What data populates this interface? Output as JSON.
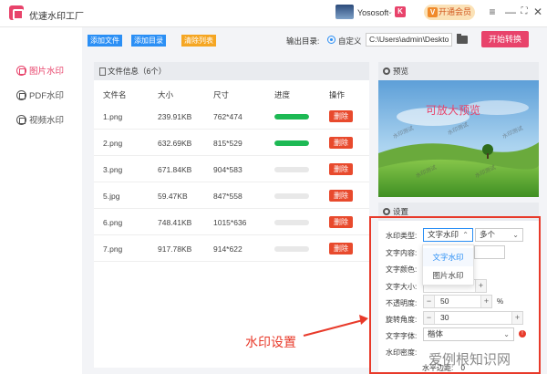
{
  "app": {
    "title": "优速水印工厂"
  },
  "user": {
    "name": "Yososoft",
    "caret": "⌄",
    "flag": "K",
    "vip_label": "开通会员",
    "vip_icon": "V"
  },
  "window": {
    "menu": "≡",
    "minimize": "—",
    "maximize": "⛶",
    "close": "✕"
  },
  "sidebar": {
    "items": [
      {
        "label": "图片水印",
        "active": true
      },
      {
        "label": "PDF水印",
        "active": false
      },
      {
        "label": "视频水印",
        "active": false
      }
    ]
  },
  "toolbar": {
    "add_file": "添加文件",
    "add_dir": "添加目录",
    "clear_list": "清除列表",
    "output_label": "输出目录:",
    "radio_label": "自定义",
    "path": "C:\\Users\\admin\\Deskto",
    "start": "开始转换"
  },
  "files": {
    "header": "文件信息（6个）",
    "columns": [
      "文件名",
      "大小",
      "尺寸",
      "进度",
      "操作"
    ],
    "delete_label": "删除",
    "rows": [
      {
        "name": "1.png",
        "size": "239.91KB",
        "dim": "762*474",
        "progress": 1.0
      },
      {
        "name": "2.png",
        "size": "632.69KB",
        "dim": "815*529",
        "progress": 1.0
      },
      {
        "name": "3.png",
        "size": "671.84KB",
        "dim": "904*583",
        "progress": 0
      },
      {
        "name": "5.jpg",
        "size": "59.47KB",
        "dim": "847*558",
        "progress": 0
      },
      {
        "name": "6.png",
        "size": "748.41KB",
        "dim": "1015*636",
        "progress": 0
      },
      {
        "name": "7.png",
        "size": "917.78KB",
        "dim": "914*622",
        "progress": 0
      }
    ]
  },
  "preview": {
    "title": "预览",
    "caption": "可放大预览",
    "watermark_text": "水印测试"
  },
  "settings": {
    "title": "设置",
    "type_label": "水印类型:",
    "type_value": "文字水印",
    "count_value": "多个",
    "text_label": "文字内容:",
    "color_label": "文字颜色:",
    "size_label": "文字大小:",
    "opacity_label": "不透明度:",
    "opacity_value": "50",
    "opacity_unit": "%",
    "rotation_label": "旋转角度:",
    "rotation_value": "30",
    "font_label": "文字字体:",
    "font_value": "楷体",
    "density_label": "水印密度:",
    "margin_label": "水平边距:",
    "margin_value": "0",
    "dropdown_options": [
      "文字水印",
      "图片水印"
    ],
    "minus": "−",
    "plus": "+",
    "warn": "!"
  },
  "annotation": {
    "label": "水印设置"
  },
  "footer_watermark": "爱例根知识网",
  "colors": {
    "accent": "#e8436b",
    "blue": "#2b8ff5",
    "delete": "#e84a2d",
    "progress": "#1db954",
    "annotation": "#e83a2a"
  }
}
